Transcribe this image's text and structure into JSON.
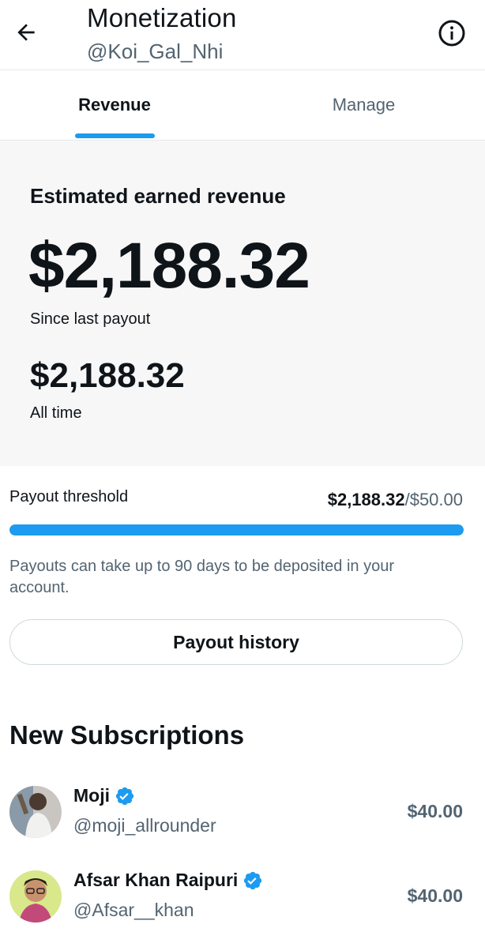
{
  "header": {
    "title": "Monetization",
    "handle": "@Koi_Gal_Nhi",
    "back_icon": "arrow-left-icon",
    "info_icon": "info-circle-icon"
  },
  "tabs": [
    {
      "label": "Revenue",
      "active": true
    },
    {
      "label": "Manage",
      "active": false
    }
  ],
  "revenue": {
    "heading": "Estimated earned revenue",
    "since_last_payout_amount": "$2,188.32",
    "since_last_payout_label": "Since last payout",
    "all_time_amount": "$2,188.32",
    "all_time_label": "All time"
  },
  "threshold": {
    "label": "Payout threshold",
    "current": "$2,188.32",
    "target": "/$50.00",
    "progress_fraction": 1.0,
    "note": "Payouts can take up to 90 days to be deposited in your account."
  },
  "payout_history_button": "Payout history",
  "subscriptions": {
    "heading": "New Subscriptions",
    "items": [
      {
        "name": "Moji",
        "handle": "@moji_allrounder",
        "amount": "$40.00",
        "verified": true
      },
      {
        "name": "Afsar Khan Raipuri",
        "handle": "@Afsar__khan",
        "amount": "$40.00",
        "verified": true
      }
    ]
  },
  "colors": {
    "accent": "#1d9bf0",
    "text_primary": "#0f1419",
    "text_secondary": "#536471",
    "panel_bg": "#f7f7f8"
  }
}
